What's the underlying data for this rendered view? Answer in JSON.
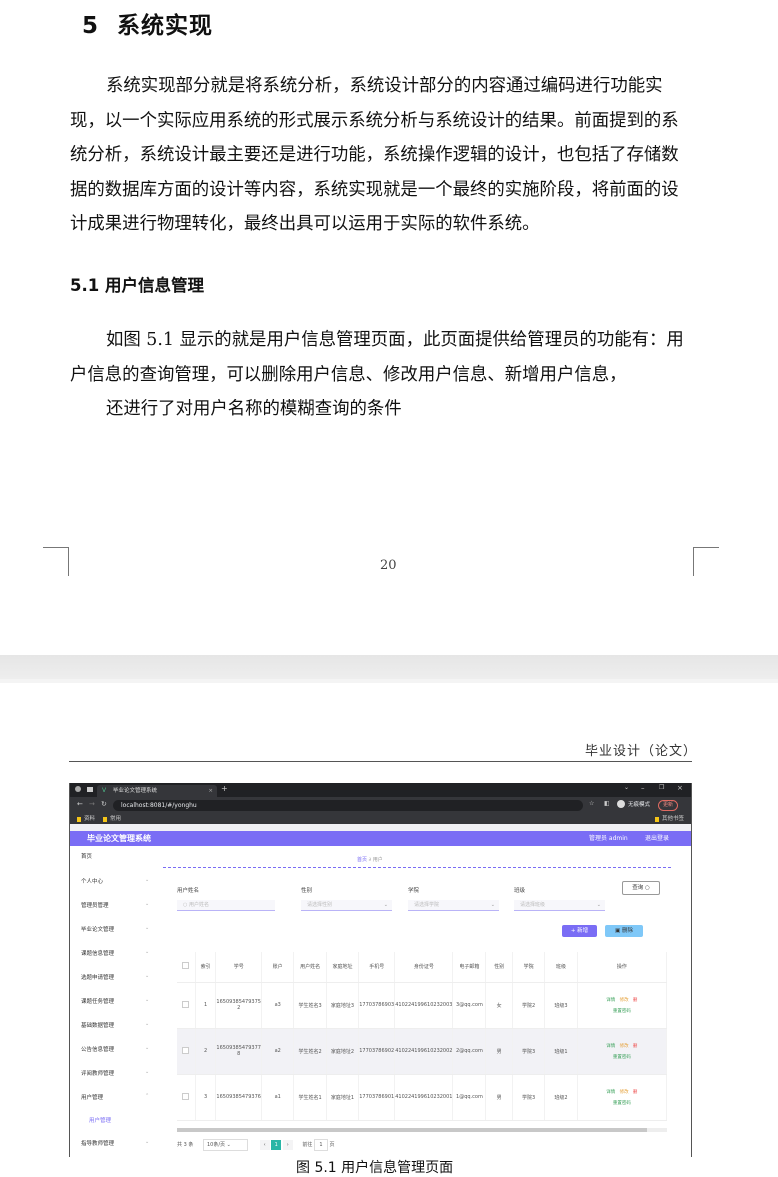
{
  "chapter": {
    "number": "5",
    "title": "系统实现"
  },
  "intro_lines": [
    "系统实现部分就是将系统分析，系统设计部分的内容通过编码进行功能实",
    "现，以一个实际应用系统的形式展示系统分析与系统设计的结果。前面提到的系",
    "统分析，系统设计最主要还是进行功能，系统操作逻辑的设计，也包括了存储数",
    "据的数据库方面的设计等内容，系统实现就是一个最终的实施阶段，将前面的设",
    "计成果进行物理转化，最终出具可以运用于实际的软件系统。"
  ],
  "section": {
    "title": "5.1 用户信息管理"
  },
  "section_lines": [
    "如图 5.1 显示的就是用户信息管理页面，此页面提供给管理员的功能有：用",
    "户信息的查询管理，可以删除用户信息、修改用户信息、新增用户信息，",
    "还进行了对用户名称的模糊查询的条件"
  ],
  "page_number": "20",
  "running_header": "毕业设计（论文）",
  "figure_caption": "图 5.1 用户信息管理页面",
  "screenshot": {
    "tab_title": "毕业论文管理系统",
    "url": "localhost:8081/#/yonghu",
    "bookmarks": [
      "资料",
      "常用"
    ],
    "bookmarks_right": "其他书签",
    "profile": "无痕模式",
    "update": "更新",
    "app_title": "毕业论文管理系统",
    "admin_label": "管理员 admin",
    "logout": "退出登录",
    "menu": [
      "首页",
      "个人中心",
      "管理员管理",
      "毕业论文管理",
      "课题信息管理",
      "选题申请管理",
      "课题任务管理",
      "基础数据管理",
      "公告信息管理",
      "评阅教师管理",
      "用户管理",
      "用户管理",
      "指导教师管理"
    ],
    "breadcrumb": [
      "首页",
      "用户"
    ],
    "filters": [
      {
        "label": "用户姓名",
        "placeholder": "用户姓名"
      },
      {
        "label": "性别",
        "placeholder": "请选择性别"
      },
      {
        "label": "学院",
        "placeholder": "请选择学院"
      },
      {
        "label": "班级",
        "placeholder": "请选择班级"
      }
    ],
    "search_btn": "查询",
    "add_btn": "新增",
    "delete_btn": "删除",
    "columns": [
      "索引",
      "学号",
      "账户",
      "用户姓名",
      "家庭地址",
      "手机号",
      "身份证号",
      "电子邮箱",
      "性别",
      "学院",
      "班级",
      "操作"
    ],
    "rows": [
      {
        "index": "1",
        "id": "16509385479375 2",
        "account": "a3",
        "name": "学生姓名3",
        "address": "家庭地址3",
        "phone": "17703786903",
        "idcard": "410224199610232003",
        "email": "3@qq.com",
        "gender": "女",
        "college": "学院2",
        "class": "班级3"
      },
      {
        "index": "2",
        "id": "16509385479377 8",
        "account": "a2",
        "name": "学生姓名2",
        "address": "家庭地址2",
        "phone": "17703786902",
        "idcard": "410224199610232002",
        "email": "2@qq.com",
        "gender": "男",
        "college": "学院3",
        "class": "班级1"
      },
      {
        "index": "3",
        "id": "16509385479376",
        "account": "a1",
        "name": "学生姓名1",
        "address": "家庭地址1",
        "phone": "17703786901",
        "idcard": "410224199610232001",
        "email": "1@qq.com",
        "gender": "男",
        "college": "学院3",
        "class": "班级2"
      }
    ],
    "row_actions": [
      "详情",
      "修改",
      "删",
      "重置密码"
    ],
    "pagination": {
      "total": "共 3 条",
      "page_size": "10条/页",
      "current": "1",
      "goto_prefix": "前往",
      "goto_value": "1",
      "goto_suffix": "页"
    }
  }
}
